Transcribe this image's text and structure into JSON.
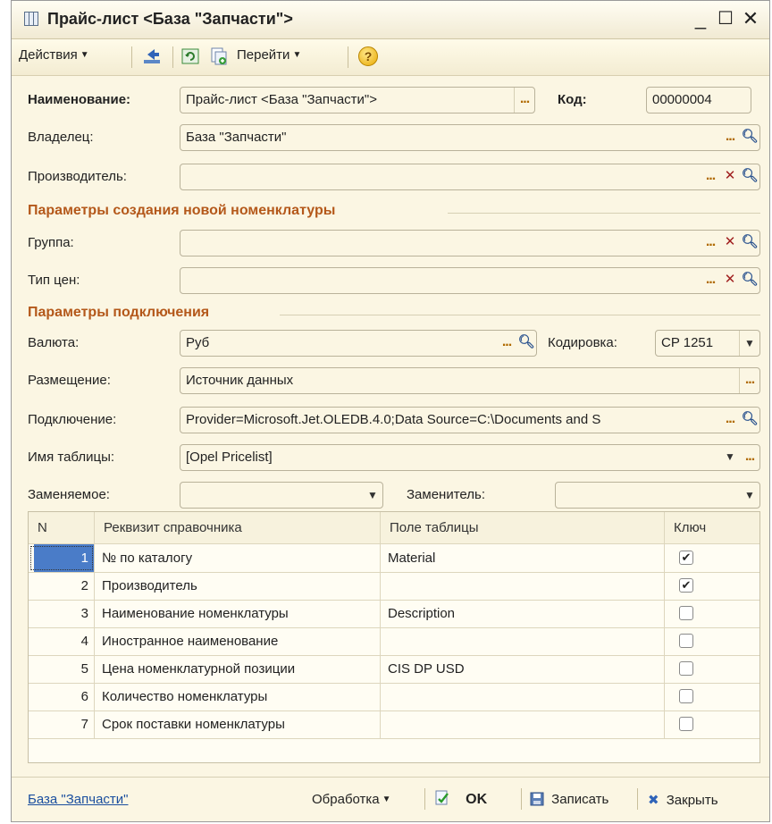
{
  "window": {
    "title": "Прайс-лист <База \"Запчасти\">",
    "controls": {
      "minimize": "_",
      "maximize": "☐",
      "close": "✕"
    }
  },
  "toolbar": {
    "actions": "Действия",
    "goto": "Перейти",
    "help": "?"
  },
  "header": {
    "name_label": "Наименование:",
    "name_value": "Прайс-лист <База \"Запчасти\">",
    "code_label": "Код:",
    "code_value": "00000004",
    "owner_label": "Владелец:",
    "owner_value": "База \"Запчасти\"",
    "manufacturer_label": "Производитель:",
    "manufacturer_value": ""
  },
  "section_new": {
    "title": "Параметры создания новой номенклатуры",
    "group_label": "Группа:",
    "group_value": "",
    "price_type_label": "Тип цен:",
    "price_type_value": ""
  },
  "section_conn": {
    "title": "Параметры подключения",
    "currency_label": "Валюта:",
    "currency_value": "Руб",
    "encoding_label": "Кодировка:",
    "encoding_value": "CP 1251",
    "placement_label": "Размещение:",
    "placement_value": "Источник данных",
    "connection_label": "Подключение:",
    "connection_value": "Provider=Microsoft.Jet.OLEDB.4.0;Data Source=C:\\Documents and S",
    "table_name_label": "Имя таблицы:",
    "table_name_value": "[Opel Pricelist]",
    "replaceable_label": "Заменяемое:",
    "replaceable_value": "",
    "replacement_label": "Заменитель:",
    "replacement_value": ""
  },
  "table": {
    "columns": [
      "N",
      "Реквизит справочника",
      "Поле таблицы",
      "Ключ"
    ],
    "rows": [
      {
        "n": "1",
        "attr": "№ по каталогу",
        "field": "Material",
        "key": true
      },
      {
        "n": "2",
        "attr": "Производитель",
        "field": "",
        "key": true
      },
      {
        "n": "3",
        "attr": "Наименование номенклатуры",
        "field": "Description",
        "key": false
      },
      {
        "n": "4",
        "attr": "Иностранное наименование",
        "field": "",
        "key": false
      },
      {
        "n": "5",
        "attr": "Цена номенклатурной позиции",
        "field": "CIS DP USD",
        "key": false
      },
      {
        "n": "6",
        "attr": "Количество номенклатуры",
        "field": "",
        "key": false
      },
      {
        "n": "7",
        "attr": "Срок поставки номенклатуры",
        "field": "",
        "key": false
      }
    ]
  },
  "footer": {
    "owner_link": "База \"Запчасти\"",
    "processing": "Обработка",
    "ok": "OK",
    "save": "Записать",
    "close": "Закрыть"
  }
}
